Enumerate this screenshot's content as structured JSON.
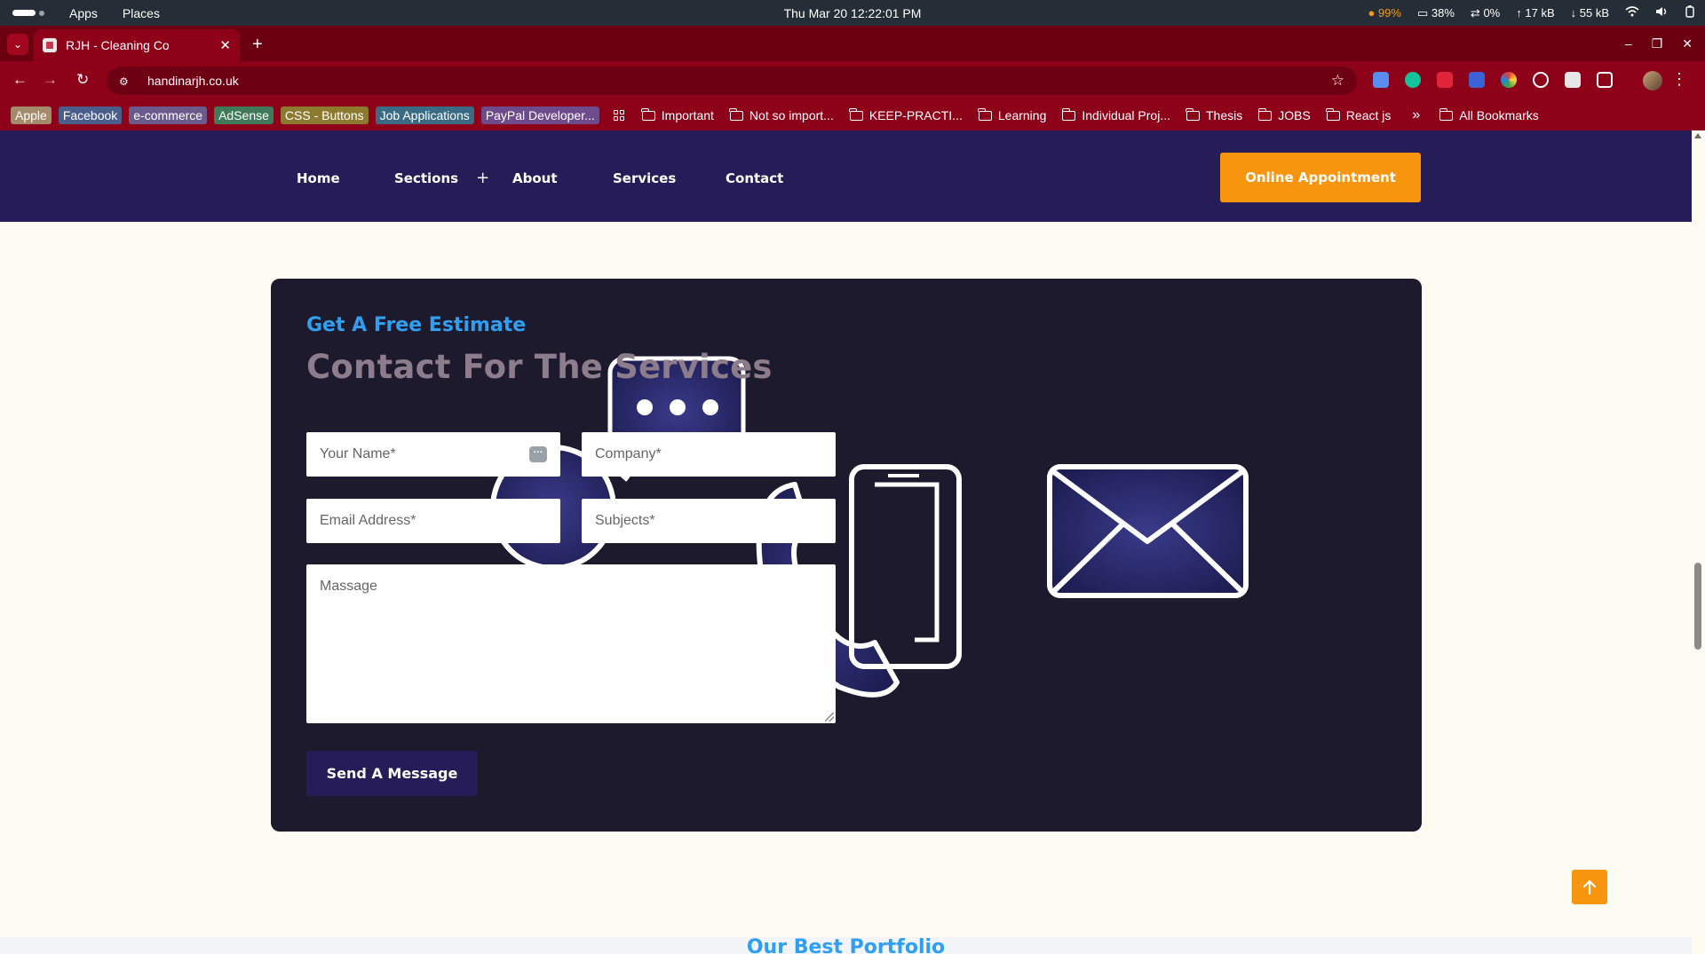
{
  "os_bar": {
    "apps_label": "Apps",
    "places_label": "Places",
    "clock": "Thu Mar 20  12:22:01 PM",
    "cpu": "99%",
    "memory": "38%",
    "swap": "0%",
    "upload": "17 kB",
    "download": "55 kB"
  },
  "browser": {
    "tab_title": "RJH - Cleaning Co",
    "url": "handinarjh.co.uk",
    "bookmarks": {
      "chips": [
        {
          "label": "Apple",
          "color": "#a48b6b"
        },
        {
          "label": "Facebook",
          "color": "#4a5e8c"
        },
        {
          "label": "e-commerce",
          "color": "#6b5a8c"
        },
        {
          "label": "AdSense",
          "color": "#3f7a5a"
        },
        {
          "label": "CSS - Buttons",
          "color": "#8c7a2e"
        },
        {
          "label": "Job Applications",
          "color": "#3a6b85"
        },
        {
          "label": "PayPal Developer...",
          "color": "#6e4b8a"
        }
      ],
      "folders": [
        "Important",
        "Not so import...",
        "KEEP-PRACTI...",
        "Learning",
        "Individual Proj...",
        "Thesis",
        "JOBS",
        "React js"
      ],
      "all_bookmarks": "All Bookmarks"
    }
  },
  "site": {
    "nav": {
      "home": "Home",
      "sections": "Sections",
      "sections_toggle": "+",
      "about": "About",
      "services": "Services",
      "contact": "Contact"
    },
    "appointment_button": "Online Appointment",
    "contact": {
      "eyebrow": "Get A Free Estimate",
      "heading": "Contact For The Services",
      "form": {
        "name_placeholder": "Your Name*",
        "company_placeholder": "Company*",
        "email_placeholder": "Email Address*",
        "subject_placeholder": "Subjects*",
        "message_placeholder": "Massage",
        "submit_label": "Send A Message"
      }
    },
    "next_section_title": "Our Best Portfolio"
  },
  "colors": {
    "header_bg": "#251c58",
    "accent_orange": "#f7950f",
    "accent_blue": "#2f9ff1",
    "card_bg": "#1c1a2c",
    "browser_red": "#8e0219"
  }
}
